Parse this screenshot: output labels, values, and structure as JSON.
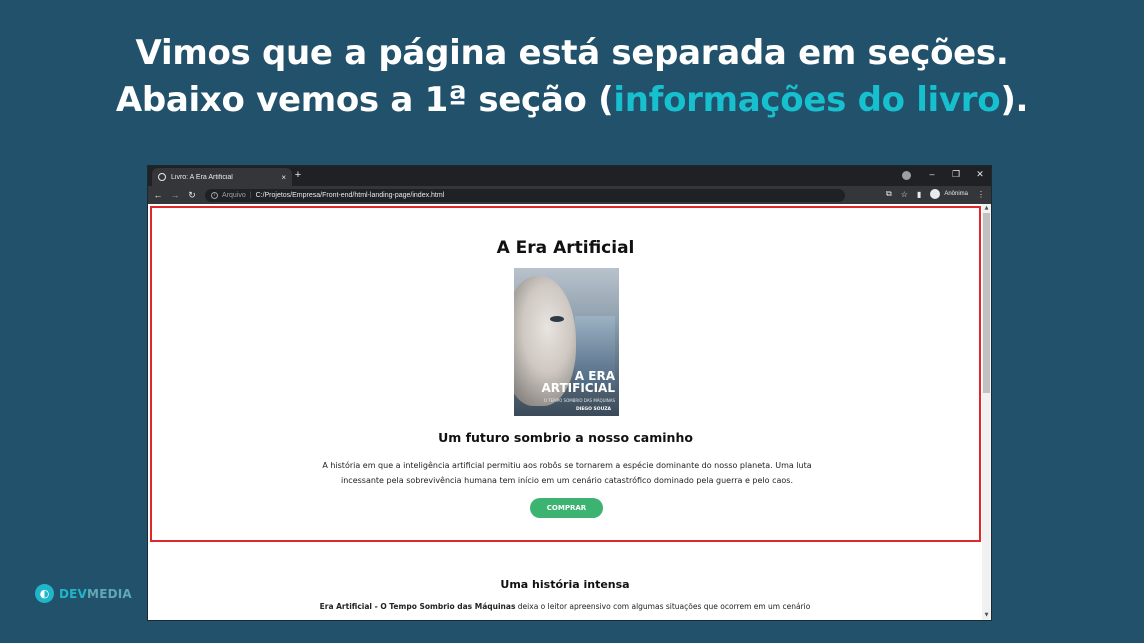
{
  "slide": {
    "line1": "Vimos que a página está separada em seções.",
    "line2_prefix": "Abaixo vemos a 1ª seção (",
    "line2_highlight": "informações do livro",
    "line2_suffix": ").",
    "highlight_color": "#17c0cf",
    "background_color": "#22526b"
  },
  "browser": {
    "tab_title": "Livro: A Era Artificial",
    "tab_close": "×",
    "new_tab": "+",
    "scheme_label": "Arquivo",
    "url": "C:/Projetos/Empresa/Front-end/html-landing-page/index.html",
    "profile_label": "Anônima",
    "icons": [
      "back-icon",
      "forward-icon",
      "reload-icon",
      "info-icon",
      "translate-icon",
      "star-icon",
      "sidepanel-icon",
      "avatar-icon",
      "menu-icon",
      "minimize-icon",
      "restore-icon",
      "close-icon"
    ]
  },
  "page": {
    "title": "A Era Artificial",
    "cover": {
      "title": "A ERA ARTIFICIAL",
      "subtitle": "O TEMPO SOMBRIO DAS MÁQUINAS",
      "author": "DIEGO SOUZA"
    },
    "subtitle": "Um futuro sombrio a nosso caminho",
    "description": "A história em que a inteligência artificial permitiu aos robôs se tornarem a espécie dominante do nosso planeta. Uma luta incessante pela sobrevivência humana tem início em um cenário catastrófico dominado pela guerra e pelo caos.",
    "buy_label": "COMPRAR",
    "buy_color": "#3cb371",
    "highlight_border_color": "#e0282b",
    "section2_title": "Uma história intensa",
    "section2_bold": "Era Artificial - O Tempo Sombrio das Máquinas",
    "section2_text": " deixa o leitor apreensivo com algumas situações que ocorrem em um cenário"
  },
  "brand": {
    "dev": "DEV",
    "media": "MEDIA"
  }
}
